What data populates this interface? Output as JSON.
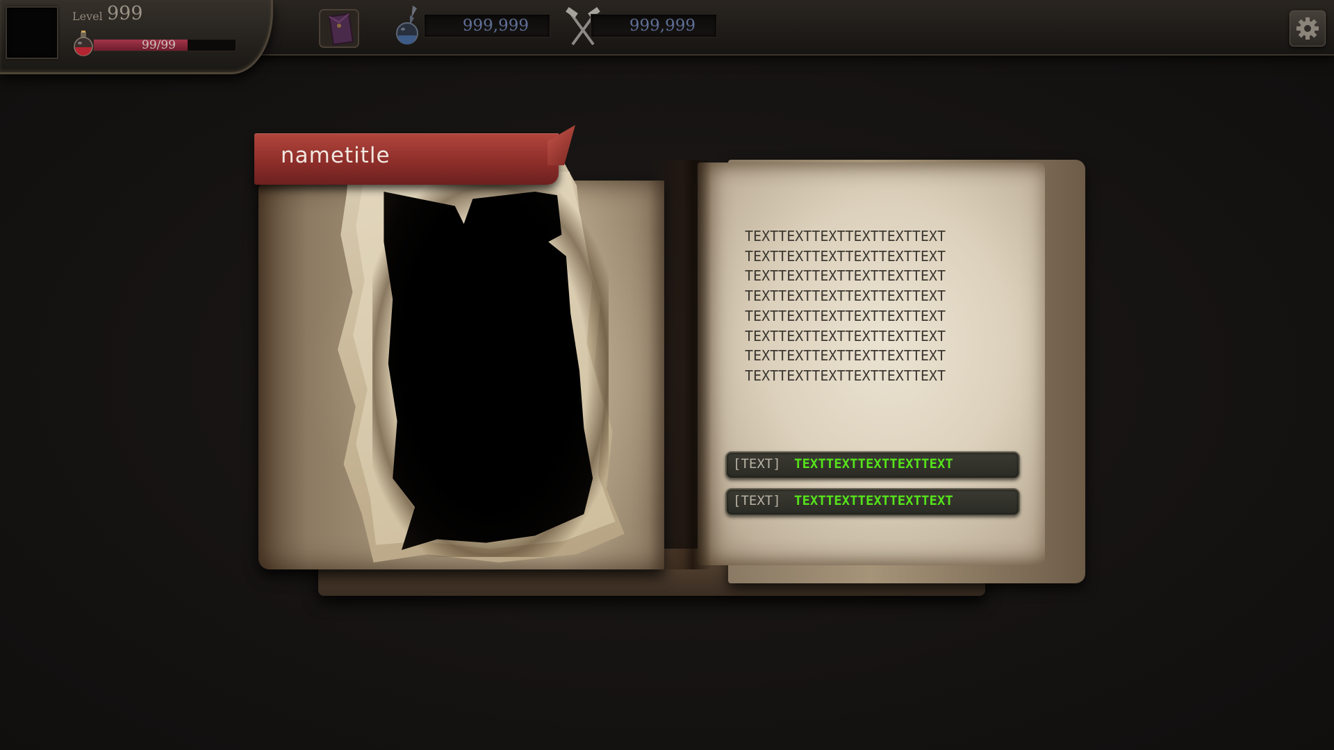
{
  "hud": {
    "level_label": "Level",
    "level_value": "999",
    "hp_text": "99/99",
    "hp_fraction": 0.66,
    "bag_icon": "bag-icon",
    "resources": [
      {
        "icon": "potion-flask-icon",
        "value": "999,999"
      },
      {
        "icon": "crossed-hammers-icon",
        "value": "999,999"
      }
    ],
    "settings_icon": "gear-icon"
  },
  "book": {
    "name_title": "nametitle",
    "description_lines": [
      "TEXTTEXTTEXTTEXTTEXTTEXT",
      "TEXTTEXTTEXTTEXTTEXTTEXT",
      "TEXTTEXTTEXTTEXTTEXTTEXT",
      "TEXTTEXTTEXTTEXTTEXTTEXT",
      "TEXTTEXTTEXTTEXTTEXTTEXT",
      "TEXTTEXTTEXTTEXTTEXTTEXT",
      "TEXTTEXTTEXTTEXTTEXTTEXT",
      "TEXTTEXTTEXTTEXTTEXTTEXT"
    ],
    "stats": [
      {
        "tag": "[TEXT]",
        "value": "TEXTTEXTTEXTTEXTTEXT"
      },
      {
        "tag": "[TEXT]",
        "value": "TEXTTEXTTEXTTEXTTEXT"
      }
    ]
  },
  "colors": {
    "ribbon_red": "#8e2e2a",
    "stat_green": "#55e21b",
    "hp_bar": "#a33449",
    "resource_text": "#5f6f96"
  }
}
